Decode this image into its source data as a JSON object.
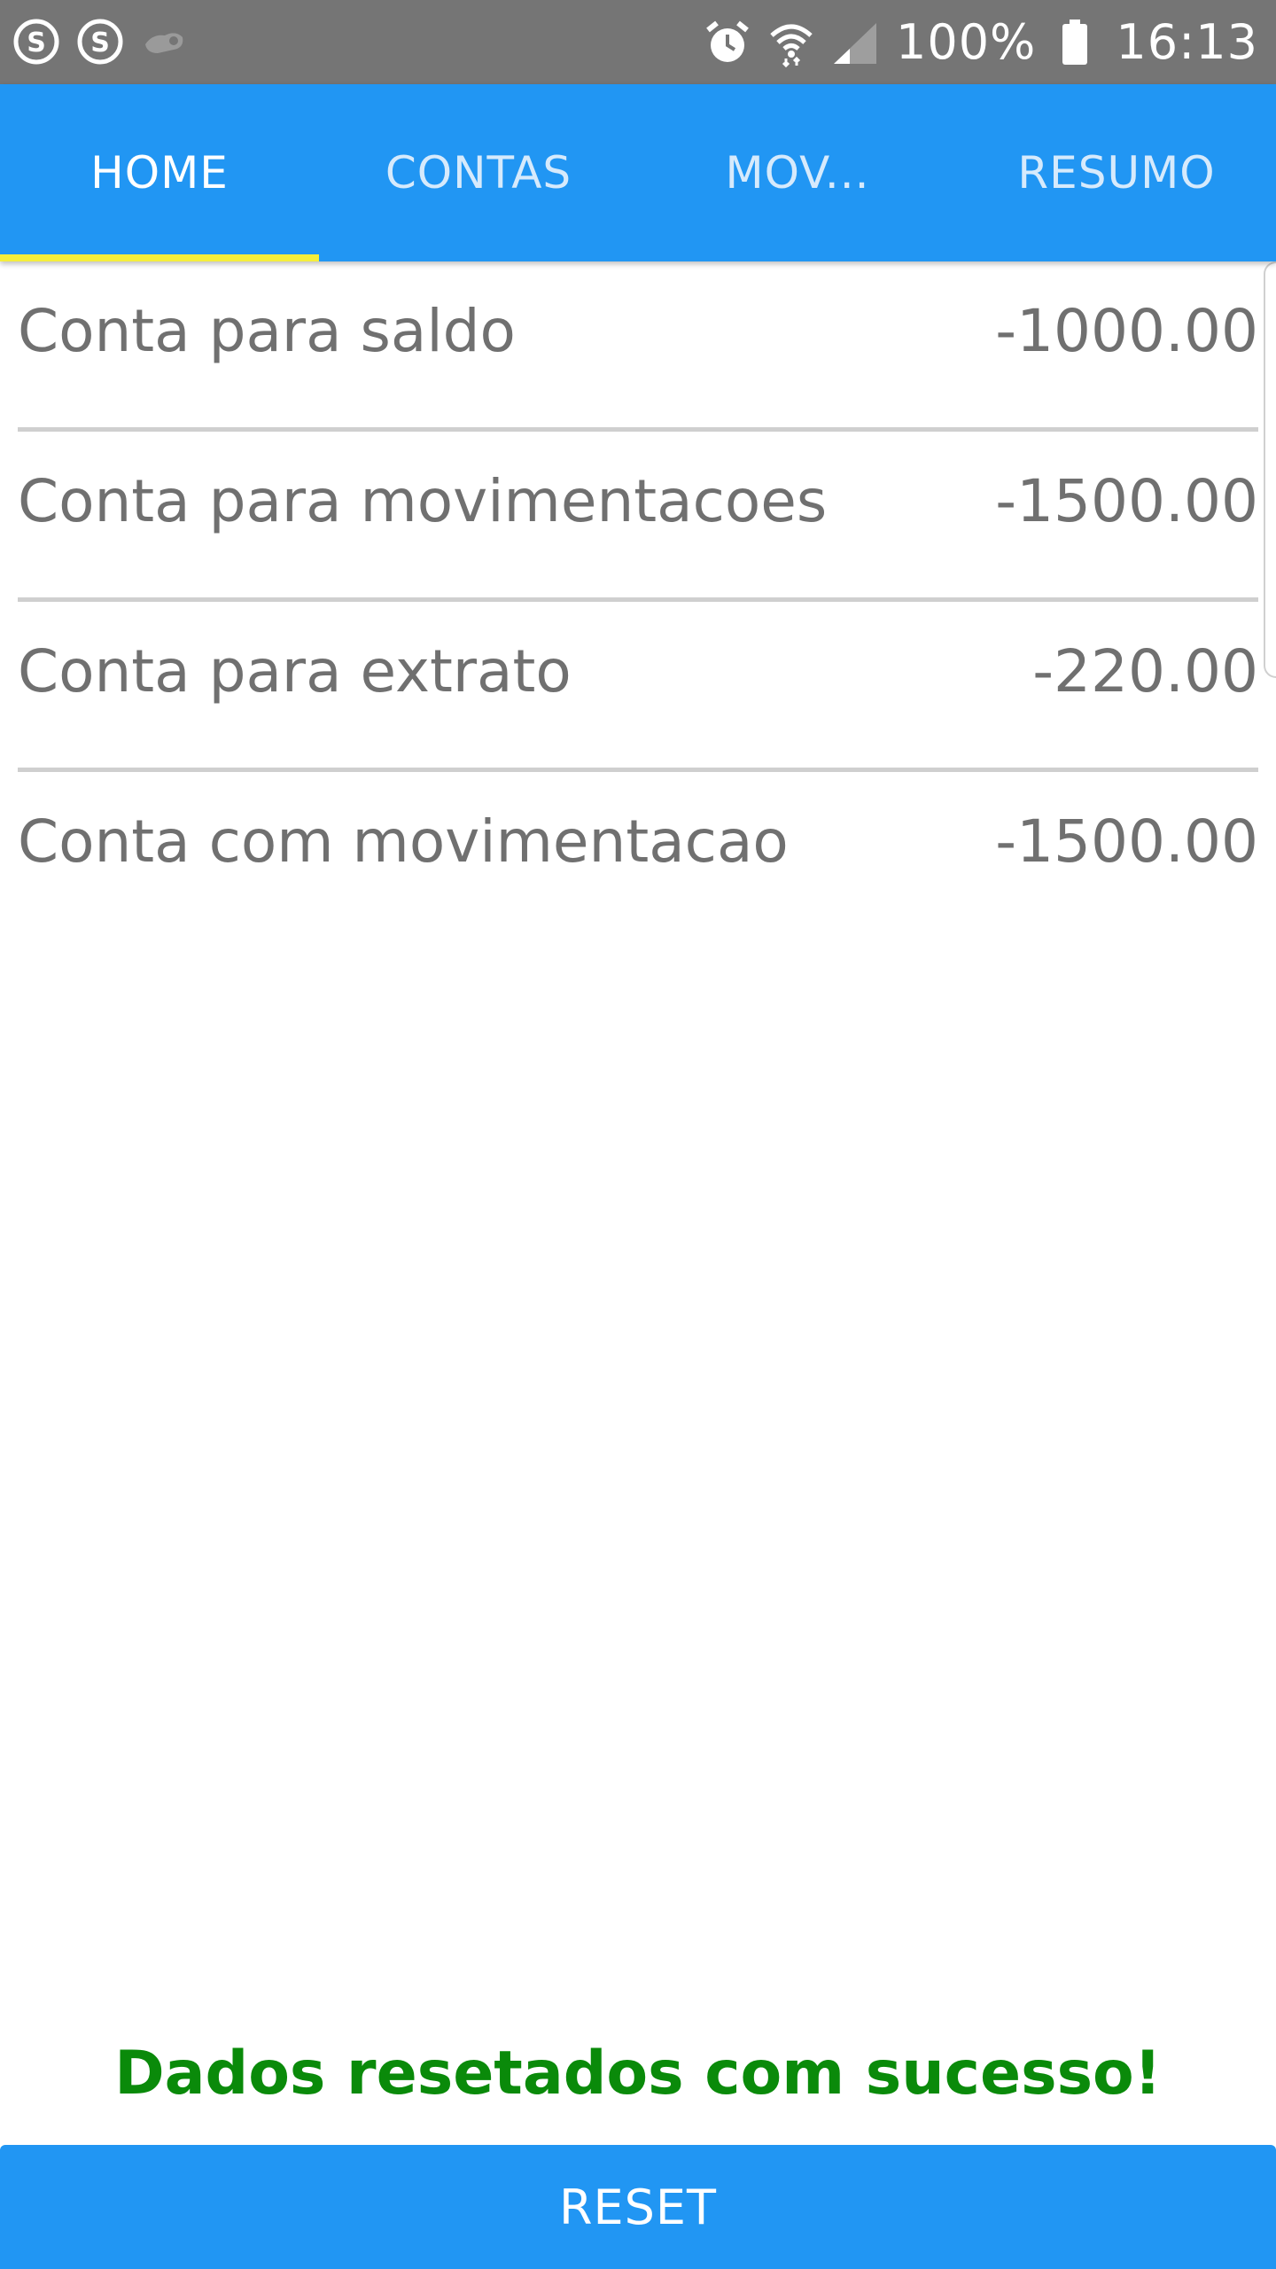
{
  "status_bar": {
    "left_icons": [
      "skype-icon",
      "skype-icon",
      "steam-icon"
    ],
    "right_icons": [
      "alarm-icon",
      "wifi-icon",
      "signal-icon",
      "battery-icon"
    ],
    "battery": "100%",
    "time": "16:13"
  },
  "tabs": [
    {
      "label": "HOME",
      "active": true
    },
    {
      "label": "CONTAS",
      "active": false
    },
    {
      "label": "MOV...",
      "active": false
    },
    {
      "label": "RESUMO",
      "active": false
    }
  ],
  "accounts": [
    {
      "name": "Conta para saldo",
      "value": "-1000.00"
    },
    {
      "name": "Conta para movimentacoes",
      "value": "-1500.00"
    },
    {
      "name": "Conta para extrato",
      "value": "-220.00"
    },
    {
      "name": "Conta com movimentacao",
      "value": "-1500.00"
    }
  ],
  "message": "Dados resetados com sucesso!",
  "reset_button": {
    "label": "RESET"
  },
  "colors": {
    "primary": "#2196f3",
    "tab_indicator": "#f5ee3a",
    "success_text": "#0a8a0a",
    "status_bar": "#757575"
  }
}
